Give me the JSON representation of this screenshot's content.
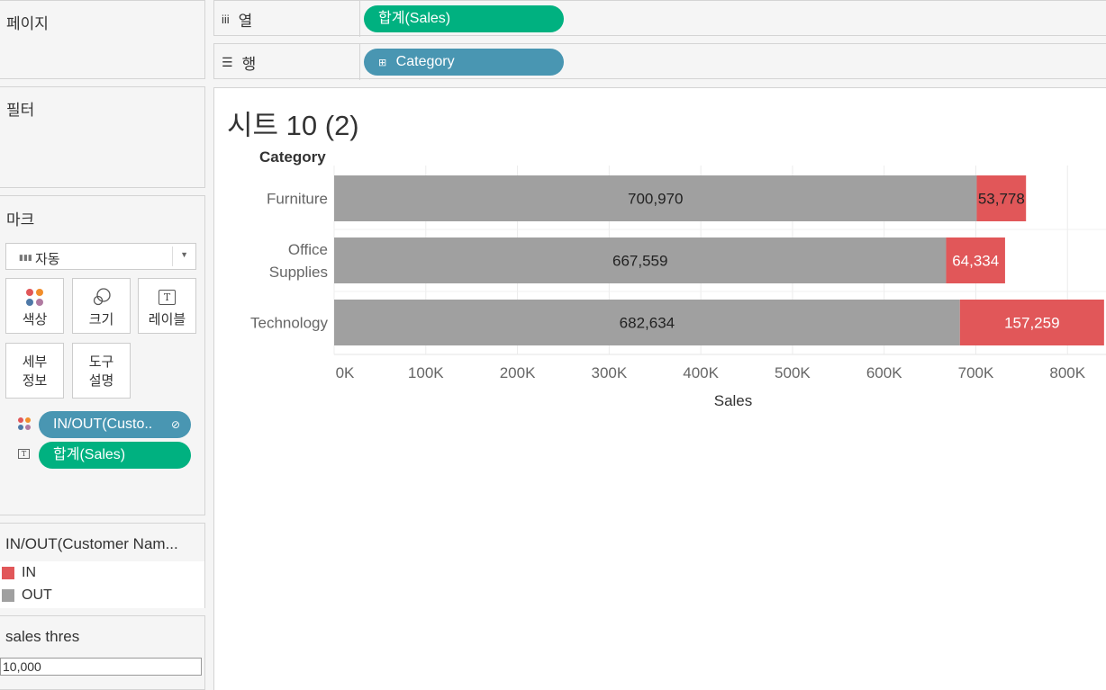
{
  "panels": {
    "pages": "페이지",
    "filters": "필터",
    "marks": "마크"
  },
  "marks": {
    "mark_type": "자동",
    "buttons": {
      "color": "색상",
      "size": "크기",
      "label": "레이블",
      "detail": "세부\n정보",
      "tooltip": "도구\n설명"
    },
    "fields": {
      "color_field": "IN/OUT(Custo..",
      "text_field": "합계(Sales)"
    }
  },
  "legend": {
    "title": "IN/OUT(Customer Nam...",
    "items": [
      {
        "label": "IN",
        "color": "#e15759"
      },
      {
        "label": "OUT",
        "color": "#a0a0a0"
      }
    ]
  },
  "parameter": {
    "title": "sales thres",
    "value": "10,000"
  },
  "shelves": {
    "columns_label": "열",
    "columns_pill": "합계(Sales)",
    "rows_label": "행",
    "rows_pill": "Category"
  },
  "sheet": {
    "title": "시트 10 (2)"
  },
  "colors": {
    "green_pill": "#00b180",
    "blue_pill": "#4996b2",
    "in": "#e15759",
    "out": "#a0a0a0"
  },
  "chart_data": {
    "type": "bar",
    "orientation": "horizontal",
    "stacked": true,
    "category_header": "Category",
    "categories": [
      "Furniture",
      "Office\nSupplies",
      "Technology"
    ],
    "series": [
      {
        "name": "OUT",
        "values": [
          700970,
          667559,
          682634
        ],
        "labels": [
          "700,970",
          "667,559",
          "682,634"
        ]
      },
      {
        "name": "IN",
        "values": [
          53778,
          64334,
          157259
        ],
        "labels": [
          "53,778",
          "64,334",
          "157,259"
        ]
      }
    ],
    "xlabel": "Sales",
    "x_ticks": [
      0,
      100000,
      200000,
      300000,
      400000,
      500000,
      600000,
      700000,
      800000
    ],
    "x_tick_labels": [
      "0K",
      "100K",
      "200K",
      "300K",
      "400K",
      "500K",
      "600K",
      "700K",
      "800K"
    ],
    "xlim": [
      0,
      842000
    ],
    "grid": true
  }
}
